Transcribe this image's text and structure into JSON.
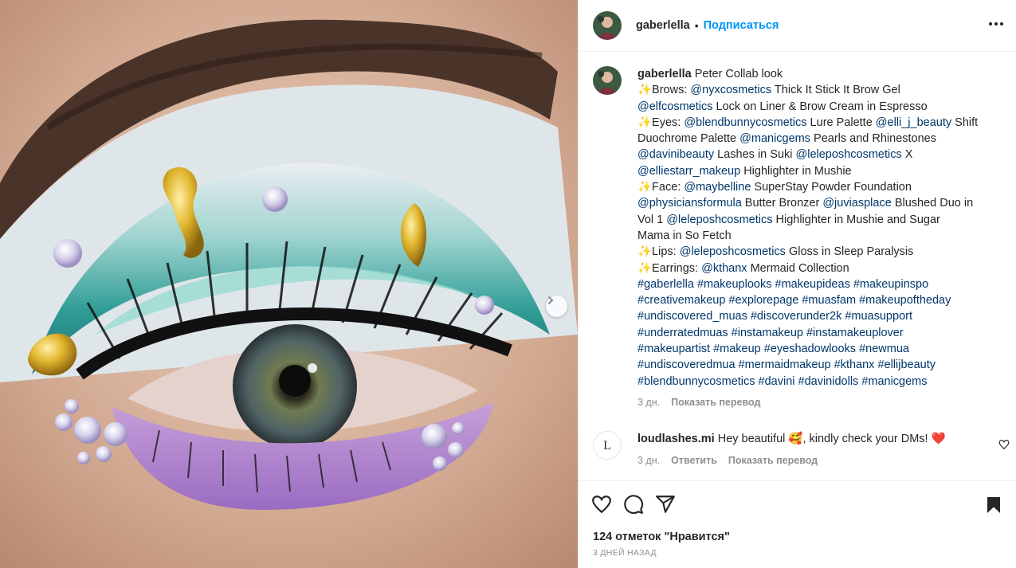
{
  "post": {
    "author": "gaberlella",
    "separator": "•",
    "follow_label": "Подписаться"
  },
  "caption": {
    "author": "gaberlella",
    "lines": [
      [
        {
          "t": "Peter Collab look"
        }
      ],
      [
        {
          "t": "✨Brows: "
        },
        {
          "t": "@nyxcosmetics",
          "c": "mention"
        },
        {
          "t": " Thick It Stick It Brow Gel"
        }
      ],
      [
        {
          "t": "@elfcosmetics",
          "c": "mention"
        },
        {
          "t": " Lock on Liner & Brow Cream in Espresso"
        }
      ],
      [
        {
          "t": "✨Eyes: "
        },
        {
          "t": "@blendbunnycosmetics",
          "c": "mention"
        },
        {
          "t": " Lure Palette "
        },
        {
          "t": "@elli_j_beauty",
          "c": "mention"
        },
        {
          "t": " Shift"
        }
      ],
      [
        {
          "t": "Duochrome Palette "
        },
        {
          "t": "@manicgems",
          "c": "mention"
        },
        {
          "t": " Pearls and Rhinestones"
        }
      ],
      [
        {
          "t": "@davinibeauty",
          "c": "mention"
        },
        {
          "t": " Lashes in Suki "
        },
        {
          "t": "@leleposhcosmetics",
          "c": "mention"
        },
        {
          "t": " X"
        }
      ],
      [
        {
          "t": "@elliestarr_makeup",
          "c": "mention"
        },
        {
          "t": " Highlighter in Mushie"
        }
      ],
      [
        {
          "t": "✨Face: "
        },
        {
          "t": "@maybelline",
          "c": "mention"
        },
        {
          "t": " SuperStay Powder Foundation"
        }
      ],
      [
        {
          "t": "@physiciansformula",
          "c": "mention"
        },
        {
          "t": " Butter Bronzer "
        },
        {
          "t": "@juviasplace",
          "c": "mention"
        },
        {
          "t": " Blushed Duo in"
        }
      ],
      [
        {
          "t": "Vol 1 "
        },
        {
          "t": "@leleposhcosmetics",
          "c": "mention"
        },
        {
          "t": " Highlighter in Mushie and Sugar"
        }
      ],
      [
        {
          "t": "Mama in So Fetch"
        }
      ],
      [
        {
          "t": "✨Lips: "
        },
        {
          "t": "@leleposhcosmetics",
          "c": "mention"
        },
        {
          "t": " Gloss in Sleep Paralysis"
        }
      ],
      [
        {
          "t": "✨Earrings: "
        },
        {
          "t": "@kthanx",
          "c": "mention"
        },
        {
          "t": " Mermaid Collection"
        }
      ],
      [
        {
          "t": "#gaberlella #makeuplooks #makeupideas #makeupinspo",
          "c": "tag"
        }
      ],
      [
        {
          "t": "#creativemakeup #explorepage #muasfam #makeupoftheday",
          "c": "tag"
        }
      ],
      [
        {
          "t": "#undiscovered_muas #discoverunder2k #muasupport",
          "c": "tag"
        }
      ],
      [
        {
          "t": "#underratedmuas #instamakeup #instamakeuplover",
          "c": "tag"
        }
      ],
      [
        {
          "t": "#makeupartist #makeup #eyeshadowlooks #newmua",
          "c": "tag"
        }
      ],
      [
        {
          "t": "#undiscoveredmua #mermaidmakeup #kthanx #ellijbeauty",
          "c": "tag"
        }
      ],
      [
        {
          "t": "#blendbunnycosmetics #davini #davinidolls #manicgems",
          "c": "tag"
        }
      ]
    ],
    "time": "3 дн.",
    "translate": "Показать перевод"
  },
  "comment": {
    "author": "loudlashes.mi",
    "text": "Hey beautiful 🥰, kindly check your DMs! ❤️",
    "time": "3 дн.",
    "reply": "Ответить",
    "translate": "Показать перевод"
  },
  "footer": {
    "likes": "124 отметок \"Нравится\"",
    "when": "3 ДНЕЙ НАЗАД"
  },
  "icons": {
    "next": "chevron-right-icon",
    "more": "more-horizontal-icon",
    "like": "heart-icon",
    "comment": "comment-icon",
    "share": "share-icon",
    "save": "bookmark-icon",
    "comment_like": "heart-icon"
  },
  "colors": {
    "link": "#0095f6",
    "hashtag": "#00376b",
    "muted": "#8e8e8e",
    "heart_emoji": "#ed4956"
  }
}
